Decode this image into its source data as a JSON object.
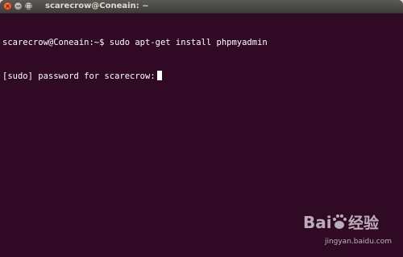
{
  "window": {
    "title": "scarecrow@Coneain: ~",
    "close_glyph": "×",
    "minimize_glyph": "−",
    "maximize_glyph": "□"
  },
  "terminal": {
    "lines": [
      "scarecrow@Coneain:~$ sudo apt-get install phpmyadmin",
      "[sudo] password for scarecrow:"
    ],
    "background_color": "#300a24",
    "text_color": "#ffffff"
  },
  "watermark": {
    "logo_text": "Baidu经验",
    "url": "jingyan.baidu.com"
  }
}
